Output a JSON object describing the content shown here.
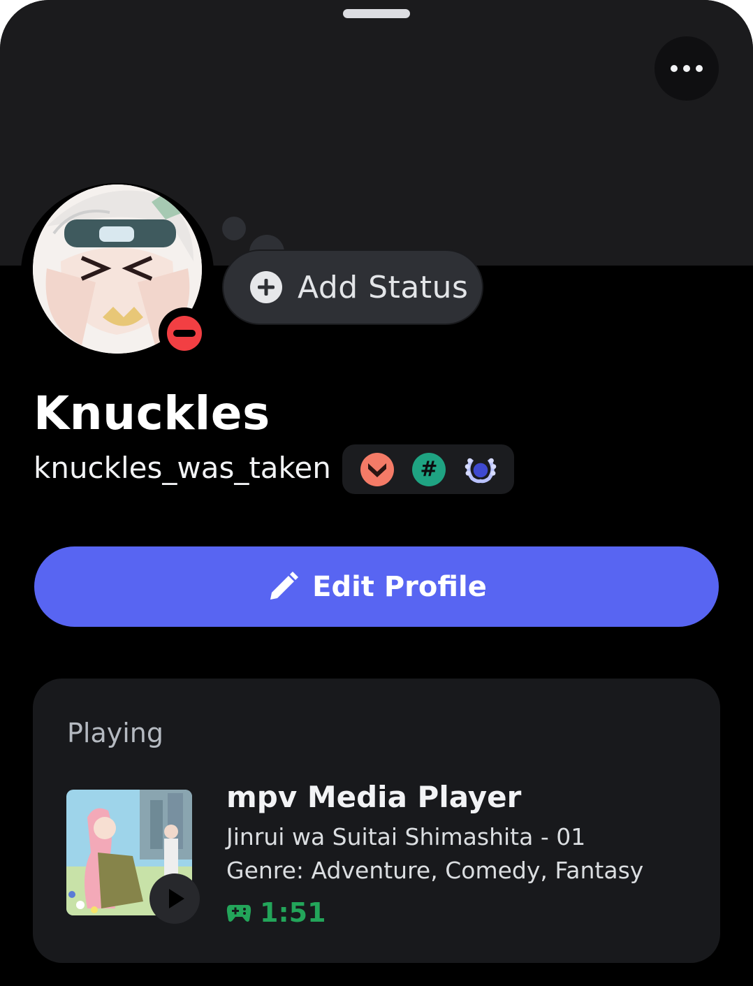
{
  "colors": {
    "banner": "#1b1b1d",
    "background": "#000000",
    "accent": "#5865f2",
    "dnd": "#f23f43",
    "elapsed_green": "#23a55a"
  },
  "header": {
    "more_icon": "more-horizontal-icon"
  },
  "profile": {
    "display_name": "Knuckles",
    "username": "knuckles_was_taken",
    "status_icon": "do-not-disturb-icon",
    "badges": [
      {
        "name": "hypesquad-badge-icon",
        "color": "#f47b67"
      },
      {
        "name": "hashtag-badge-icon",
        "glyph": "#",
        "color": "#1fa382"
      },
      {
        "name": "laurel-badge-icon",
        "color": "#b9c2ff"
      }
    ]
  },
  "status_button": {
    "label": "Add Status",
    "icon": "plus-circle-icon"
  },
  "edit_button": {
    "label": "Edit Profile",
    "icon": "pencil-icon"
  },
  "activity": {
    "heading": "Playing",
    "app_name": "mpv Media Player",
    "details": "Jinrui wa Suitai Shimashita - 01",
    "state": "Genre: Adventure, Comedy, Fantasy",
    "elapsed": "1:51",
    "elapsed_icon": "gamepad-icon",
    "play_icon": "play-icon"
  }
}
